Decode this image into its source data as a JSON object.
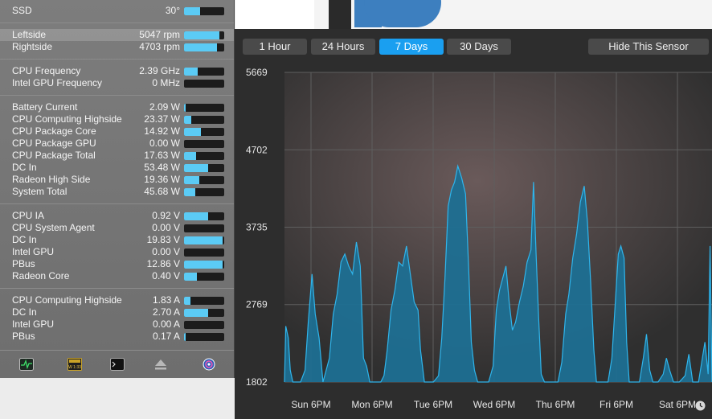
{
  "sensors": {
    "groups": [
      [
        {
          "name": "SSD",
          "value": "30°",
          "fill": 0.4
        }
      ],
      [
        {
          "name": "Leftside",
          "value": "5047 rpm",
          "fill": 0.88,
          "highlight": true
        },
        {
          "name": "Rightside",
          "value": "4703 rpm",
          "fill": 0.82
        }
      ],
      [
        {
          "name": "CPU Frequency",
          "value": "2.39 GHz",
          "fill": 0.34
        },
        {
          "name": "Intel GPU Frequency",
          "value": "0 MHz",
          "fill": 0
        }
      ],
      [
        {
          "name": "Battery Current",
          "value": "2.09 W",
          "fill": 0.03
        },
        {
          "name": "CPU Computing Highside",
          "value": "23.37 W",
          "fill": 0.17
        },
        {
          "name": "CPU Package Core",
          "value": "14.92 W",
          "fill": 0.42
        },
        {
          "name": "CPU Package GPU",
          "value": "0.00 W",
          "fill": 0
        },
        {
          "name": "CPU Package Total",
          "value": "17.63 W",
          "fill": 0.3
        },
        {
          "name": "DC In",
          "value": "53.48 W",
          "fill": 0.6
        },
        {
          "name": "Radeon High Side",
          "value": "19.36 W",
          "fill": 0.38
        },
        {
          "name": "System Total",
          "value": "45.68 W",
          "fill": 0.28
        }
      ],
      [
        {
          "name": "CPU IA",
          "value": "0.92 V",
          "fill": 0.6
        },
        {
          "name": "CPU System Agent",
          "value": "0.00 V",
          "fill": 0
        },
        {
          "name": "DC In",
          "value": "19.83 V",
          "fill": 0.95
        },
        {
          "name": "Intel GPU",
          "value": "0.00 V",
          "fill": 0
        },
        {
          "name": "PBus",
          "value": "12.86 V",
          "fill": 0.96
        },
        {
          "name": "Radeon Core",
          "value": "0.40 V",
          "fill": 0.32
        }
      ],
      [
        {
          "name": "CPU Computing Highside",
          "value": "1.83 A",
          "fill": 0.15
        },
        {
          "name": "DC In",
          "value": "2.70 A",
          "fill": 0.6
        },
        {
          "name": "Intel GPU",
          "value": "0.00 A",
          "fill": 0
        },
        {
          "name": "PBus",
          "value": "0.17 A",
          "fill": 0.03
        }
      ]
    ]
  },
  "toolbar": {
    "icons": [
      "activity-monitor-icon",
      "hardware-monitor-icon",
      "terminal-icon",
      "eject-icon",
      "istat-icon"
    ],
    "hardware_label": "W 1:33"
  },
  "history": {
    "tabs": [
      {
        "label": "1 Hour",
        "active": false
      },
      {
        "label": "24 Hours",
        "active": false
      },
      {
        "label": "7 Days",
        "active": true
      },
      {
        "label": "30 Days",
        "active": false
      }
    ],
    "hide_button": "Hide This Sensor",
    "clock_icon": "clock-icon"
  },
  "colors": {
    "accent": "#1a9ff0",
    "bar_fill": "#5bcbf5",
    "area_fill": "#1e6f92",
    "line": "#2fb5ec"
  },
  "chart_data": {
    "type": "area",
    "title": "",
    "xlabel": "",
    "ylabel": "",
    "y_ticks": [
      1802,
      2769,
      3735,
      4702,
      5669
    ],
    "ylim": [
      1802,
      5669
    ],
    "x_ticks": [
      "Sun 6PM",
      "Mon 6PM",
      "Tue 6PM",
      "Wed 6PM",
      "Thu 6PM",
      "Fri 6PM",
      "Sat 6PM"
    ],
    "grid": true,
    "series": [
      {
        "name": "",
        "points": [
          [
            0.0,
            1802
          ],
          [
            0.2,
            2500
          ],
          [
            0.6,
            2350
          ],
          [
            0.9,
            1950
          ],
          [
            1.3,
            1802
          ],
          [
            2.5,
            1802
          ],
          [
            3.2,
            1950
          ],
          [
            3.7,
            2550
          ],
          [
            4.3,
            3150
          ],
          [
            4.8,
            2650
          ],
          [
            5.4,
            2350
          ],
          [
            6.0,
            1802
          ],
          [
            7.0,
            2100
          ],
          [
            7.6,
            2650
          ],
          [
            8.2,
            2900
          ],
          [
            8.8,
            3300
          ],
          [
            9.4,
            3400
          ],
          [
            10.0,
            3250
          ],
          [
            10.6,
            3150
          ],
          [
            11.2,
            3550
          ],
          [
            11.8,
            3250
          ],
          [
            12.3,
            2100
          ],
          [
            12.8,
            2000
          ],
          [
            13.3,
            1802
          ],
          [
            14.0,
            1802
          ],
          [
            15.0,
            1802
          ],
          [
            15.5,
            1880
          ],
          [
            16.0,
            2200
          ],
          [
            16.6,
            2700
          ],
          [
            17.2,
            2950
          ],
          [
            17.8,
            3300
          ],
          [
            18.4,
            3250
          ],
          [
            19.0,
            3500
          ],
          [
            19.6,
            3150
          ],
          [
            20.2,
            2800
          ],
          [
            20.8,
            2700
          ],
          [
            21.2,
            2200
          ],
          [
            21.8,
            1802
          ],
          [
            22.5,
            1802
          ],
          [
            23.2,
            1802
          ],
          [
            24.0,
            1880
          ],
          [
            24.5,
            2350
          ],
          [
            25.0,
            3100
          ],
          [
            25.5,
            4000
          ],
          [
            26.0,
            4200
          ],
          [
            26.5,
            4300
          ],
          [
            27.0,
            4500
          ],
          [
            27.6,
            4350
          ],
          [
            28.2,
            4150
          ],
          [
            28.7,
            3200
          ],
          [
            29.1,
            2300
          ],
          [
            29.6,
            1950
          ],
          [
            30.1,
            1802
          ],
          [
            31.0,
            1802
          ],
          [
            31.8,
            1802
          ],
          [
            32.5,
            2000
          ],
          [
            33.0,
            2700
          ],
          [
            33.5,
            2950
          ],
          [
            34.0,
            3100
          ],
          [
            34.5,
            3250
          ],
          [
            35.0,
            2800
          ],
          [
            35.5,
            2450
          ],
          [
            36.0,
            2550
          ],
          [
            36.6,
            2800
          ],
          [
            37.2,
            3000
          ],
          [
            37.8,
            3300
          ],
          [
            38.4,
            3450
          ],
          [
            38.8,
            4300
          ],
          [
            39.2,
            3400
          ],
          [
            39.6,
            2600
          ],
          [
            40.0,
            1900
          ],
          [
            40.5,
            1802
          ],
          [
            41.0,
            1802
          ],
          [
            41.8,
            1802
          ],
          [
            42.6,
            1802
          ],
          [
            43.2,
            2050
          ],
          [
            43.8,
            2650
          ],
          [
            44.3,
            2900
          ],
          [
            44.9,
            3350
          ],
          [
            45.5,
            3650
          ],
          [
            46.1,
            4050
          ],
          [
            46.7,
            4250
          ],
          [
            47.2,
            3800
          ],
          [
            47.7,
            3050
          ],
          [
            48.2,
            2200
          ],
          [
            48.6,
            1802
          ],
          [
            49.5,
            1802
          ],
          [
            50.4,
            1802
          ],
          [
            51.0,
            2100
          ],
          [
            51.5,
            2750
          ],
          [
            52.0,
            3400
          ],
          [
            52.4,
            3500
          ],
          [
            52.9,
            3350
          ],
          [
            53.3,
            2300
          ],
          [
            53.7,
            1802
          ],
          [
            54.6,
            1802
          ],
          [
            55.3,
            1802
          ],
          [
            55.9,
            2100
          ],
          [
            56.4,
            2400
          ],
          [
            56.9,
            1950
          ],
          [
            57.4,
            1802
          ],
          [
            58.2,
            1802
          ],
          [
            59.0,
            1900
          ],
          [
            59.5,
            2100
          ],
          [
            60.0,
            1950
          ],
          [
            60.6,
            1802
          ],
          [
            61.5,
            1802
          ],
          [
            62.4,
            1880
          ],
          [
            63.0,
            2150
          ],
          [
            63.6,
            1802
          ],
          [
            64.5,
            1802
          ],
          [
            65.0,
            2050
          ],
          [
            65.5,
            2300
          ],
          [
            66.0,
            1900
          ],
          [
            66.3,
            3500
          ],
          [
            66.6,
            1802
          ]
        ]
      }
    ]
  }
}
